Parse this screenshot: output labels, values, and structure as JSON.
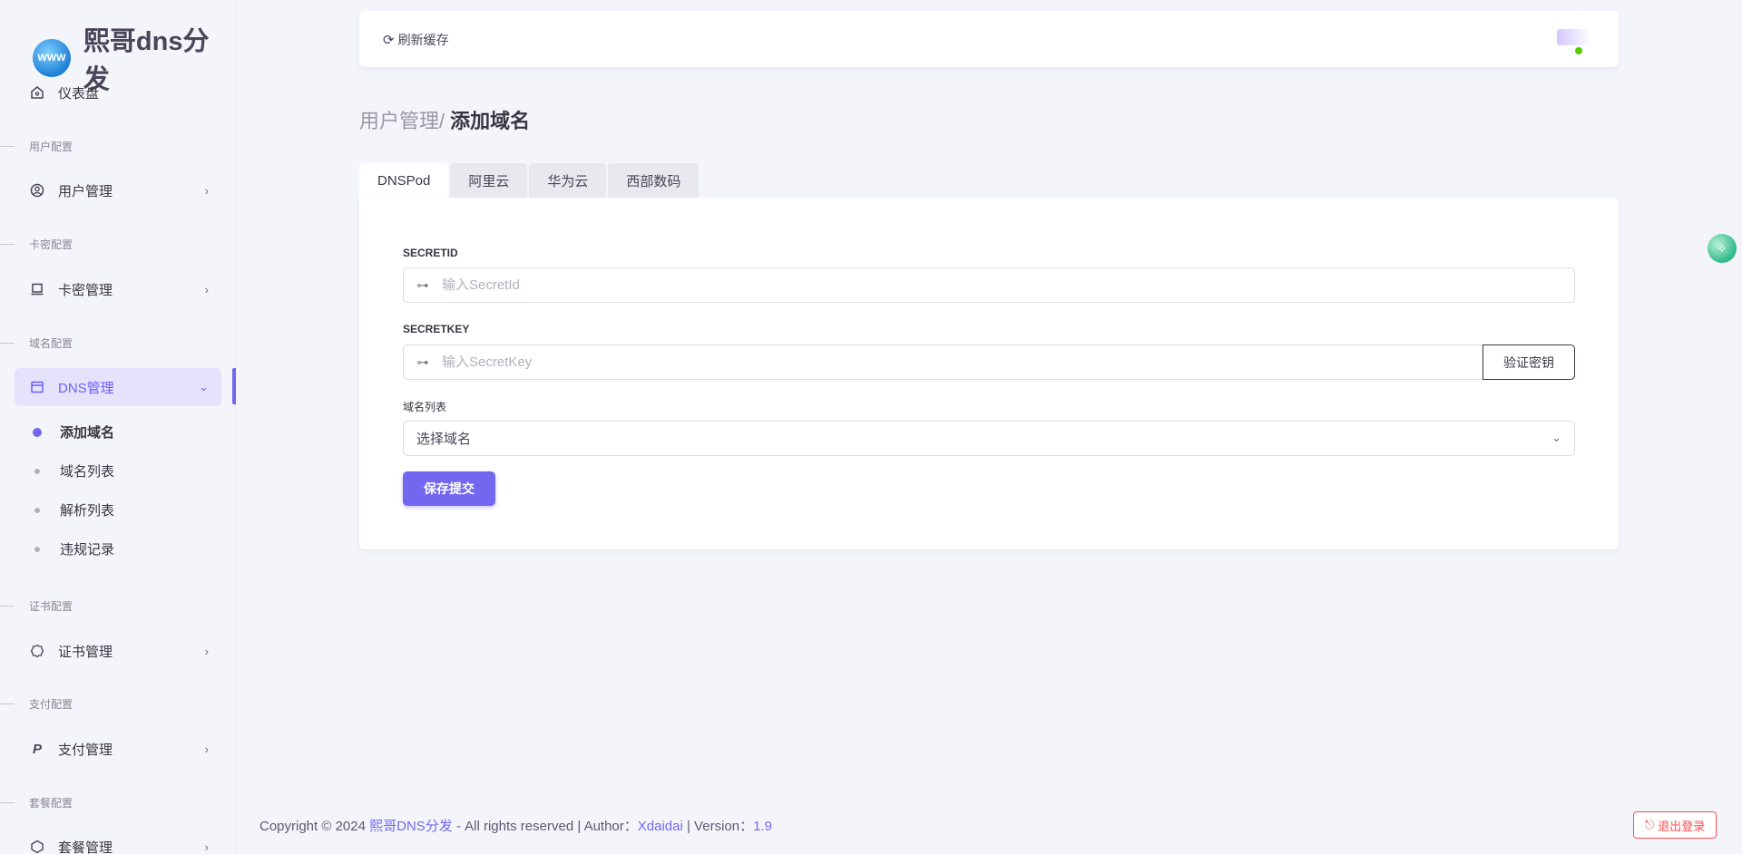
{
  "brand": {
    "title": "熙哥dns分发",
    "logo_text": "WWW"
  },
  "sidebar": {
    "dashboard": "仪表盘",
    "sections": {
      "user": "用户配置",
      "card": "卡密配置",
      "domain": "域名配置",
      "cert": "证书配置",
      "pay": "支付配置",
      "plan": "套餐配置"
    },
    "items": {
      "user_mgmt": "用户管理",
      "card_mgmt": "卡密管理",
      "dns_mgmt": "DNS管理",
      "cert_mgmt": "证书管理",
      "pay_mgmt": "支付管理",
      "plan_mgmt": "套餐管理"
    },
    "dns_sub": [
      "添加域名",
      "域名列表",
      "解析列表",
      "违规记录"
    ]
  },
  "topbar": {
    "refresh_label": "刷新缓存"
  },
  "breadcrumb": {
    "parent": "用户管理",
    "separator": "/",
    "current": "添加域名"
  },
  "tabs": [
    "DNSPod",
    "阿里云",
    "华为云",
    "西部数码"
  ],
  "form": {
    "secret_id_label": "SECRETID",
    "secret_id_placeholder": "输入SecretId",
    "secret_key_label": "SECRETKEY",
    "secret_key_placeholder": "输入SecretKey",
    "verify_label": "验证密钥",
    "domain_list_label": "域名列表",
    "domain_select_value": "选择域名",
    "submit_label": "保存提交"
  },
  "footer": {
    "prefix": "Copyright © 2024 ",
    "site": "熙哥DNS分发",
    "middle": " - All rights reserved | Author：",
    "author": "Xdaidai",
    "version_prefix": " | Version：",
    "version": "1.9"
  },
  "logout_label": "退出登录",
  "colors": {
    "accent": "#7367f0",
    "danger": "#ff4c51",
    "online": "#56ca00"
  }
}
